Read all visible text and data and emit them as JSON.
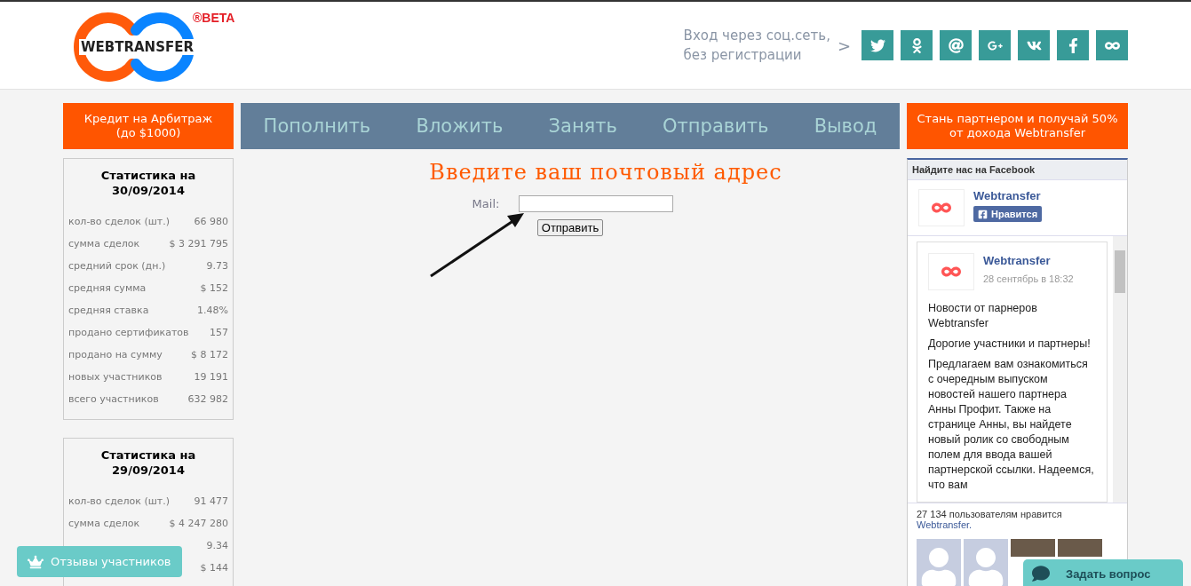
{
  "header": {
    "logo_text": "WEBTRANSFER",
    "logo_badge": "®BETA",
    "login_hint": [
      "Вход через соц.сеть,",
      "без регистрации"
    ],
    "chevron": ">",
    "socials": [
      {
        "kind": "twitter"
      },
      {
        "kind": "odnoklassniki"
      },
      {
        "kind": "mail"
      },
      {
        "kind": "googleplus"
      },
      {
        "kind": "vk"
      },
      {
        "kind": "facebook"
      },
      {
        "kind": "webtransfer"
      }
    ]
  },
  "promo_left": [
    "Кредит на Арбитраж",
    "(до $1000)"
  ],
  "nav": [
    "Пополнить",
    "Вложить",
    "Занять",
    "Отправить",
    "Вывод"
  ],
  "promo_right": [
    "Стань партнером и получай 50%",
    "от дохода Webtransfer"
  ],
  "stats": [
    {
      "title": [
        "Статистика на",
        "30/09/2014"
      ],
      "rows": [
        {
          "label": "кол-во сделок (шт.)",
          "value": "66 980"
        },
        {
          "label": "сумма сделок",
          "value": "$ 3 291 795"
        },
        {
          "label": "средний срок (дн.)",
          "value": "9.73"
        },
        {
          "label": "средняя сумма",
          "value": "$ 152"
        },
        {
          "label": "средняя ставка",
          "value": "1.48%"
        },
        {
          "label": "продано сертификатов",
          "value": "157"
        },
        {
          "label": "продано на сумму",
          "value": "$ 8 172"
        },
        {
          "label": "новых участников",
          "value": "19 191"
        },
        {
          "label": "всего участников",
          "value": "632 982"
        }
      ]
    },
    {
      "title": [
        "Статистика на",
        "29/09/2014"
      ],
      "rows": [
        {
          "label": "кол-во сделок (шт.)",
          "value": "91 477"
        },
        {
          "label": "сумма сделок",
          "value": "$ 4 247 280"
        },
        {
          "value": "9.34"
        },
        {
          "value": "$ 144"
        }
      ]
    }
  ],
  "form": {
    "title": "Введите ваш почтовый адрес",
    "label": "Mail:",
    "submit": "Отправить"
  },
  "facebook": {
    "header": "Найдите нас на Facebook",
    "page_name": "Webtransfer",
    "like_button": "Нравится",
    "post": {
      "author": "Webtransfer",
      "date": "28 сентябрь в 18:32",
      "paragraphs": [
        "Новости от парнеров Webtransfer",
        "Дорогие участники и партнеры!",
        "Предлагаем вам ознакомиться с очередным выпуском новостей нашего партнера Анны Профит. Также на странице Анны, вы найдете новый ролик со свободным полем для ввода вашей партнерской ссылки. Надеемся, что вам"
      ]
    },
    "likes_text": "27 134 пользователям нравится",
    "likes_link": "Webtransfer.",
    "faces": [
      {
        "kind": "silhouette"
      },
      {
        "kind": "silhouette"
      },
      {
        "kind": "photo"
      },
      {
        "kind": "photo"
      }
    ]
  },
  "reviews_button": "Отзывы участников",
  "ask_button": "Задать вопрос"
}
